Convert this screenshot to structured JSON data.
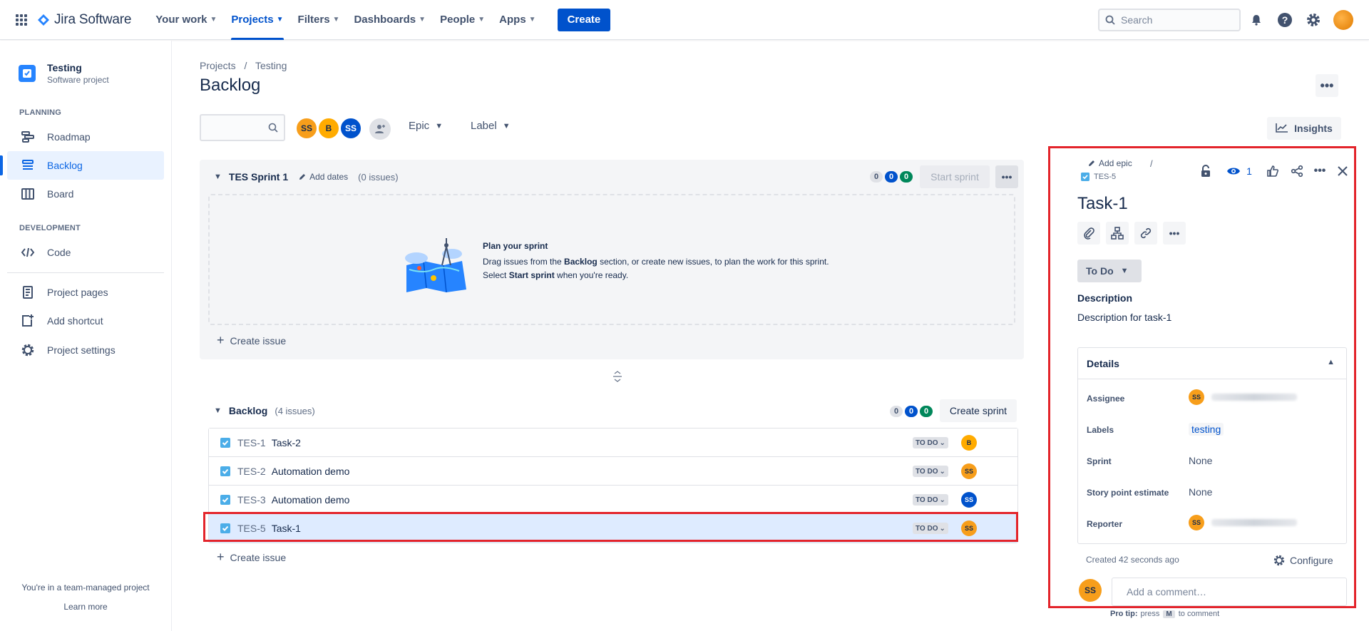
{
  "topnav": {
    "product_name": "Jira Software",
    "items": [
      {
        "label": "Your work"
      },
      {
        "label": "Projects"
      },
      {
        "label": "Filters"
      },
      {
        "label": "Dashboards"
      },
      {
        "label": "People"
      },
      {
        "label": "Apps"
      }
    ],
    "active_item": "Projects",
    "create_label": "Create",
    "search_placeholder": "Search",
    "icons": [
      "app-switcher-icon",
      "jira-logo-icon",
      "notifications-icon",
      "help-icon",
      "settings-icon"
    ],
    "accent_color": "#0052cc"
  },
  "sidebar": {
    "project_name": "Testing",
    "project_type": "Software project",
    "planning_title": "PLANNING",
    "planning_items": [
      {
        "label": "Roadmap",
        "icon": "roadmap-icon"
      },
      {
        "label": "Backlog",
        "icon": "backlog-icon",
        "active": true
      },
      {
        "label": "Board",
        "icon": "board-icon"
      }
    ],
    "development_title": "DEVELOPMENT",
    "development_items": [
      {
        "label": "Code",
        "icon": "code-icon"
      }
    ],
    "other_items": [
      {
        "label": "Project pages",
        "icon": "page-icon"
      },
      {
        "label": "Add shortcut",
        "icon": "add-shortcut-icon"
      },
      {
        "label": "Project settings",
        "icon": "settings-icon"
      }
    ],
    "footer_text": "You're in a team-managed project",
    "footer_link": "Learn more"
  },
  "main": {
    "breadcrumb": [
      "Projects",
      "Testing"
    ],
    "breadcrumb_sep": "/",
    "title": "Backlog",
    "more_label": "•••",
    "avatars": [
      {
        "initials": "SS",
        "color": "#f79e1b"
      },
      {
        "initials": "B",
        "color": "#f79e1b"
      },
      {
        "initials": "SS",
        "color": "#0052cc"
      }
    ],
    "filters": [
      {
        "label": "Epic"
      },
      {
        "label": "Label"
      }
    ],
    "insights_label": "Insights",
    "sprint": {
      "name": "TES Sprint 1",
      "add_dates_label": "Add dates",
      "issue_count_label": "(0 issues)",
      "counts": [
        "0",
        "0",
        "0"
      ],
      "start_sprint_label": "Start sprint",
      "more_label": "•••",
      "plan_title": "Plan your sprint",
      "plan_text_parts": [
        "Drag issues from the ",
        "Backlog",
        " section, or create new issues, to plan the work for this sprint. Select ",
        "Start sprint",
        " when you're ready."
      ],
      "create_issue_label": "Create issue"
    },
    "backlog": {
      "name": "Backlog",
      "issue_count_label": "(4 issues)",
      "counts": [
        "0",
        "0",
        "0"
      ],
      "create_sprint_label": "Create sprint",
      "create_issue_label": "Create issue",
      "issues": [
        {
          "key": "TES-1",
          "summary": "Task-2",
          "status": "TO DO",
          "assignee": "B",
          "assignee_color": "#f79e1b"
        },
        {
          "key": "TES-2",
          "summary": "Automation demo",
          "status": "TO DO",
          "assignee": "SS",
          "assignee_color": "#f79e1b"
        },
        {
          "key": "TES-3",
          "summary": "Automation demo",
          "status": "TO DO",
          "assignee": "SS",
          "assignee_color": "#0052cc"
        },
        {
          "key": "TES-5",
          "summary": "Task-1",
          "status": "TO DO",
          "assignee": "SS",
          "assignee_color": "#f79e1b",
          "selected": true
        }
      ]
    }
  },
  "detail": {
    "add_epic_label": "Add epic",
    "breadcrumb_sep": "/",
    "issue_key": "TES-5",
    "watch_count": "1",
    "title": "Task-1",
    "status_label": "To Do",
    "description_heading": "Description",
    "description": "Description for task-1",
    "details_heading": "Details",
    "fields": [
      {
        "label": "Assignee",
        "value": "",
        "avatar": "SS",
        "blurred": true
      },
      {
        "label": "Labels",
        "value": "testing",
        "is_tag": true
      },
      {
        "label": "Sprint",
        "value": "None"
      },
      {
        "label": "Story point estimate",
        "value": "None"
      },
      {
        "label": "Reporter",
        "value": "",
        "avatar": "SS",
        "blurred": true
      }
    ],
    "created_label": "Created 42 seconds ago",
    "configure_label": "Configure",
    "comment_avatar": "SS",
    "comment_placeholder": "Add a comment…",
    "pro_tip_prefix": "Pro tip:",
    "pro_tip_press": "press",
    "pro_tip_key": "M",
    "pro_tip_suffix": "to comment"
  },
  "highlight_color": "#e3242b"
}
